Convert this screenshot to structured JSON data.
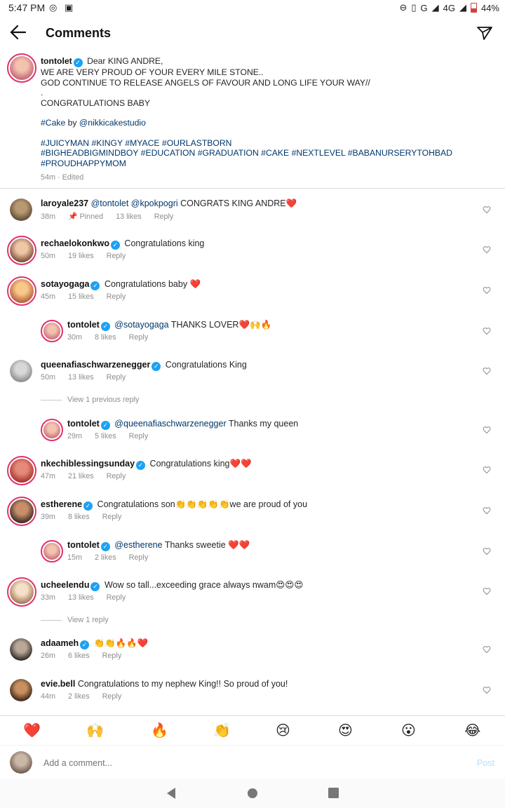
{
  "status_bar": {
    "time": "5:47 PM",
    "network": "G",
    "network2": "4G",
    "battery": "44%",
    "battery_level": 0.44
  },
  "header": {
    "title": "Comments"
  },
  "caption": {
    "username": "tontolet",
    "line1": "Dear KING ANDRE,",
    "line2": "WE ARE VERY PROUD OF YOUR EVERY MILE STONE..",
    "line3": "GOD CONTINUE TO RELEASE ANGELS OF FAVOUR AND LONG LIFE YOUR WAY//",
    "line4": ".",
    "line5": "CONGRATULATIONS BABY",
    "cake_tag": "#Cake",
    "by": "by",
    "cake_mention": "@nikkicakestudio",
    "hashtags1": "#JUICYMAN #KINGY #MYACE #OURLASTBORN",
    "hashtags2": "#BIGHEADBIGMINDBOY #EDUCATION #GRADUATION #CAKE #NEXTLEVEL #BABANURSERYTOHBAD",
    "hashtags3": "#PROUDHAPPYMOM",
    "time": "54m · Edited"
  },
  "comments": [
    {
      "user": "laroyale237",
      "mentions": "@tontolet  @kpokpogri",
      "text": " CONGRATS KING ANDRE❤️",
      "time": "38m",
      "pinned": "Pinned",
      "likes": "13 likes",
      "reply": "Reply"
    },
    {
      "user": "rechaelokonkwo",
      "mentions": "",
      "text": "Congratulations king",
      "time": "50m",
      "likes": "19 likes",
      "reply": "Reply"
    },
    {
      "user": "sotayogaga",
      "mentions": "",
      "text": "Congratulations baby ❤️",
      "time": "45m",
      "likes": "15 likes",
      "reply": "Reply"
    },
    {
      "user": "tontolet",
      "mentions": "@sotayogaga",
      "text": " THANKS LOVER❤️🙌🔥",
      "time": "30m",
      "likes": "8 likes",
      "reply": "Reply"
    },
    {
      "user": "queenafiaschwarzenegger",
      "mentions": "",
      "text": "Congratulations King",
      "time": "50m",
      "likes": "13 likes",
      "reply": "Reply"
    },
    {
      "user": "tontolet",
      "mentions": "@queenafiaschwarzenegger",
      "text": " Thanks my queen",
      "time": "29m",
      "likes": "5 likes",
      "reply": "Reply"
    },
    {
      "user": "nkechiblessingsunday",
      "mentions": "",
      "text": "Congratulations king❤️❤️",
      "time": "47m",
      "likes": "21 likes",
      "reply": "Reply"
    },
    {
      "user": "estherene",
      "mentions": "",
      "text": "Congratulations son👏👏👏👏👏we are proud of you",
      "time": "39m",
      "likes": "8 likes",
      "reply": "Reply"
    },
    {
      "user": "tontolet",
      "mentions": "@estherene",
      "text": " Thanks sweetie ❤️❤️",
      "time": "15m",
      "likes": "2 likes",
      "reply": "Reply"
    },
    {
      "user": "ucheelendu",
      "mentions": "",
      "text": "Wow so tall...exceeding grace always nwam😍😍😍",
      "time": "33m",
      "likes": "13 likes",
      "reply": "Reply"
    },
    {
      "user": "adaameh",
      "mentions": "",
      "text": "👏👏🔥🔥❤️",
      "time": "26m",
      "likes": "6 likes",
      "reply": "Reply"
    },
    {
      "user": "evie.bell",
      "mentions": "",
      "text": "Congratulations to my nephew King!! So proud of you!",
      "time": "44m",
      "likes": "2 likes",
      "reply": "Reply"
    }
  ],
  "view_previous": "View 1 previous reply",
  "view_reply": "View 1 reply",
  "emojis": [
    "❤️",
    "🙌",
    "🔥",
    "👏",
    "😢",
    "😍",
    "😮",
    "😂"
  ],
  "add_comment": {
    "placeholder": "Add a comment...",
    "post": "Post"
  },
  "colors": {
    "ring": "#e1306c",
    "verified": "#1da1f2",
    "link": "#00376b",
    "meta": "#8e8e8e"
  }
}
